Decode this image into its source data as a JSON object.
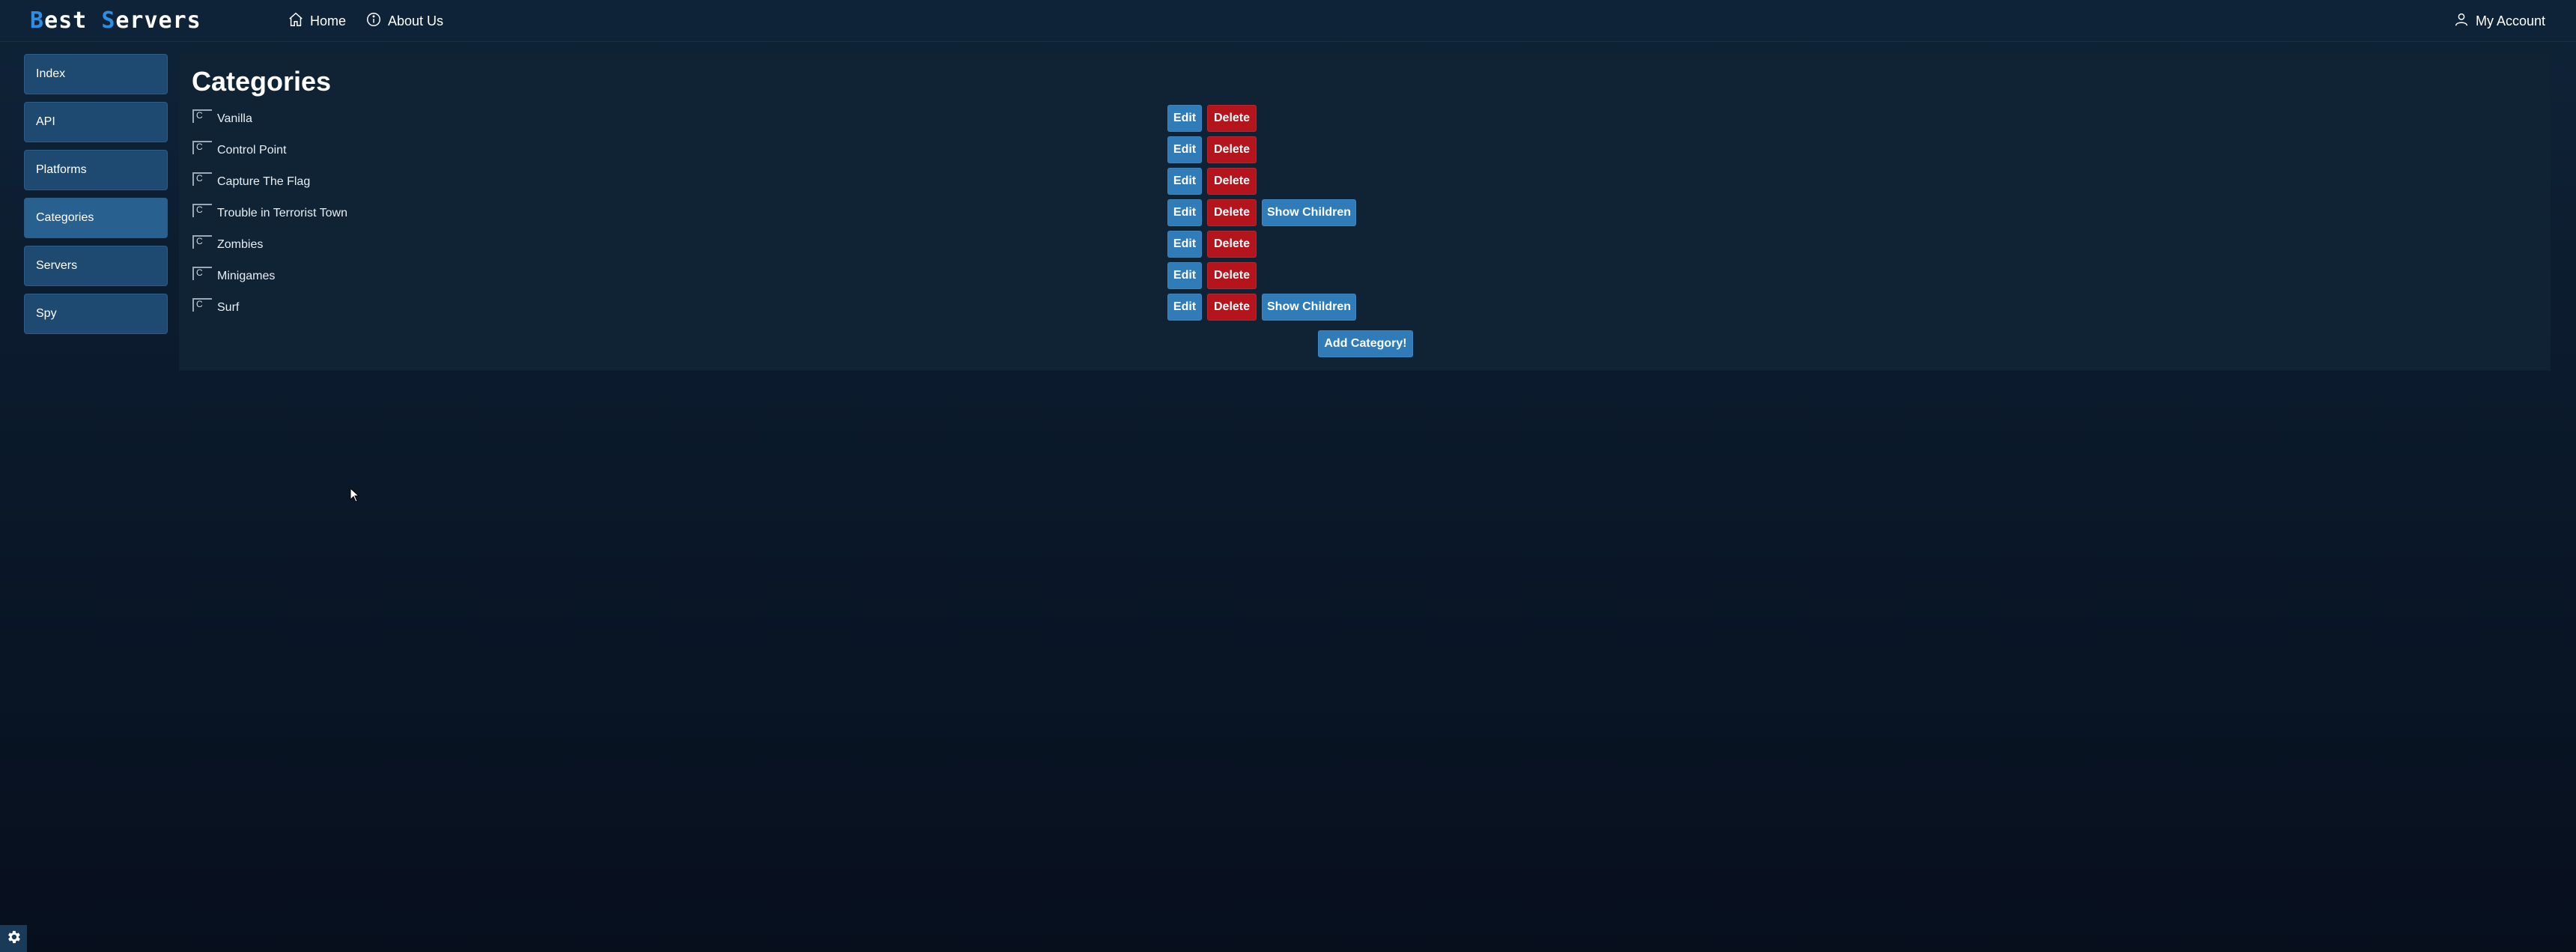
{
  "brand": {
    "first_initial": "B",
    "first_rest": "est ",
    "second_initial": "S",
    "second_rest": "ervers"
  },
  "nav": {
    "home": {
      "label": "Home",
      "icon": "home-icon"
    },
    "about": {
      "label": "About Us",
      "icon": "info-icon"
    },
    "account": {
      "label": "My Account",
      "icon": "user-icon"
    }
  },
  "sidebar": {
    "items": [
      {
        "label": "Index"
      },
      {
        "label": "API"
      },
      {
        "label": "Platforms"
      },
      {
        "label": "Categories"
      },
      {
        "label": "Servers"
      },
      {
        "label": "Spy"
      }
    ]
  },
  "main": {
    "title": "Categories",
    "rows": [
      {
        "name": "Vanilla",
        "img_alt": "C",
        "has_children": false
      },
      {
        "name": "Control Point",
        "img_alt": "C",
        "has_children": false
      },
      {
        "name": "Capture The Flag",
        "img_alt": "C",
        "has_children": false
      },
      {
        "name": "Trouble in Terrorist Town",
        "img_alt": "C",
        "has_children": true
      },
      {
        "name": "Zombies",
        "img_alt": "C",
        "has_children": false
      },
      {
        "name": "Minigames",
        "img_alt": "C",
        "has_children": false
      },
      {
        "name": "Surf",
        "img_alt": "C",
        "has_children": true
      }
    ],
    "edit_label": "Edit",
    "delete_label": "Delete",
    "children_label": "Show Children",
    "add_label": "Add Category!"
  },
  "colors": {
    "accent": "#2d8ee6",
    "primary_button": "#2f7cb9",
    "danger_button": "#b4151c",
    "sidebar_item": "#1e4a72",
    "background": "#0b1a2c"
  },
  "settings": {
    "icon": "gear-icon"
  }
}
